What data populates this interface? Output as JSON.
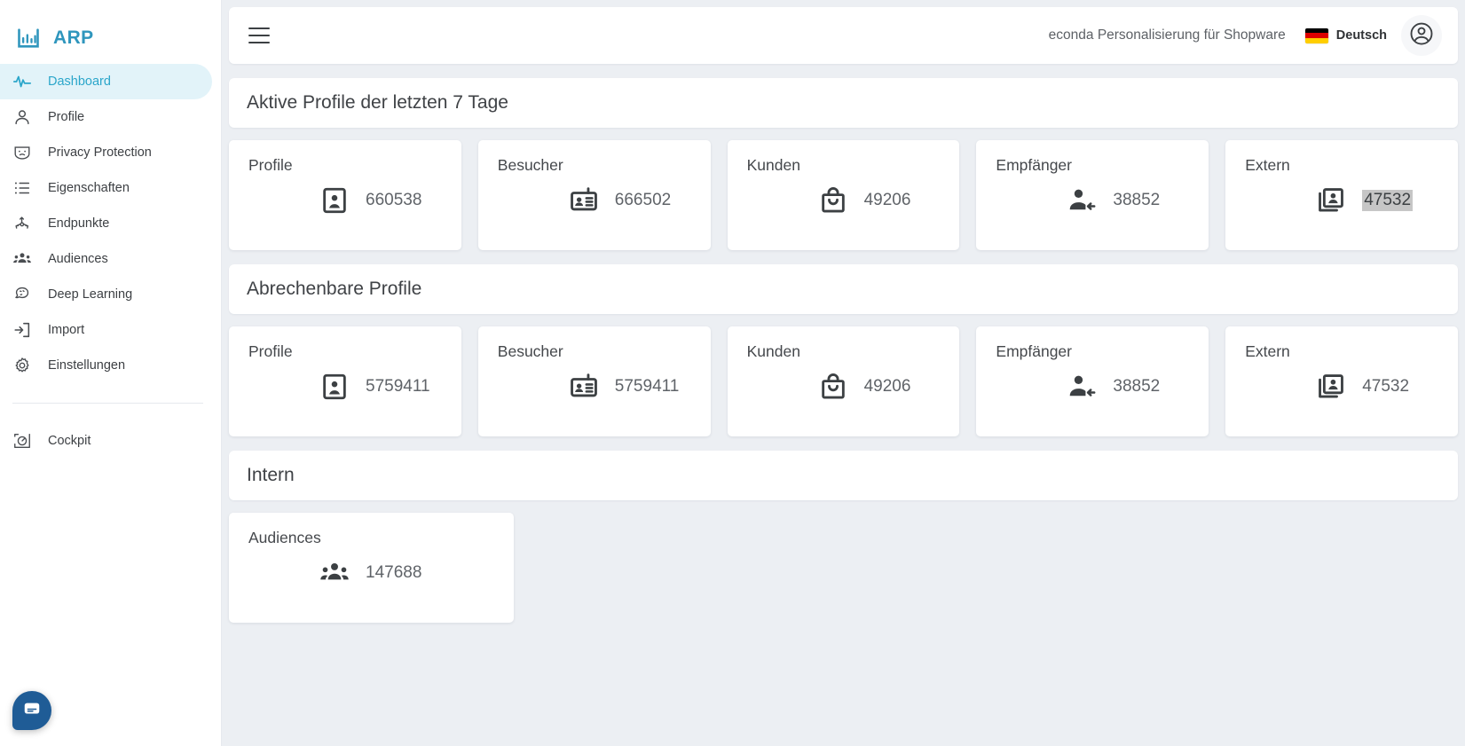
{
  "brand": {
    "label": "ARP",
    "icon": "bar-chart-icon",
    "color": "#2f96bd"
  },
  "sidebar": {
    "items": [
      {
        "label": "Dashboard",
        "icon": "pulse-icon",
        "active": true
      },
      {
        "label": "Profile",
        "icon": "person-icon",
        "active": false
      },
      {
        "label": "Privacy Protection",
        "icon": "mask-icon",
        "active": false
      },
      {
        "label": "Eigenschaften",
        "icon": "list-icon",
        "active": false
      },
      {
        "label": "Endpunkte",
        "icon": "nodes-icon",
        "active": false
      },
      {
        "label": "Audiences",
        "icon": "group-icon",
        "active": false
      },
      {
        "label": "Deep Learning",
        "icon": "brain-icon",
        "active": false
      },
      {
        "label": "Import",
        "icon": "import-arrow-icon",
        "active": false
      },
      {
        "label": "Einstellungen",
        "icon": "gear-icon",
        "active": false
      }
    ],
    "footer_items": [
      {
        "label": "Cockpit",
        "icon": "gauge-icon",
        "active": false
      }
    ],
    "chat_button": {
      "icon": "chat-bubble-icon",
      "color": "#1f5c96"
    }
  },
  "topbar": {
    "menu_icon": "hamburger-icon",
    "tenant": "econda Personalisierung für Shopware",
    "language": {
      "label": "Deutsch",
      "flag": "germany-flag-icon"
    },
    "avatar_icon": "account-circle-icon"
  },
  "sections": [
    {
      "title": "Aktive Profile der letzten 7 Tage",
      "cards": [
        {
          "title": "Profile",
          "value": "660538",
          "icon": "account-box-icon",
          "selected": false
        },
        {
          "title": "Besucher",
          "value": "666502",
          "icon": "id-badge-icon",
          "selected": false
        },
        {
          "title": "Kunden",
          "value": "49206",
          "icon": "shopping-bag-icon",
          "selected": false
        },
        {
          "title": "Empfänger",
          "value": "38852",
          "icon": "person-arrow-icon",
          "selected": false
        },
        {
          "title": "Extern",
          "value": "47532",
          "icon": "contacts-icon",
          "selected": true
        }
      ]
    },
    {
      "title": "Abrechenbare Profile",
      "cards": [
        {
          "title": "Profile",
          "value": "5759411",
          "icon": "account-box-icon",
          "selected": false
        },
        {
          "title": "Besucher",
          "value": "5759411",
          "icon": "id-badge-icon",
          "selected": false
        },
        {
          "title": "Kunden",
          "value": "49206",
          "icon": "shopping-bag-icon",
          "selected": false
        },
        {
          "title": "Empfänger",
          "value": "38852",
          "icon": "person-arrow-icon",
          "selected": false
        },
        {
          "title": "Extern",
          "value": "47532",
          "icon": "contacts-icon",
          "selected": false
        }
      ]
    },
    {
      "title": "Intern",
      "cards": [
        {
          "title": "Audiences",
          "value": "147688",
          "icon": "group-filled-icon",
          "selected": false
        }
      ]
    }
  ]
}
